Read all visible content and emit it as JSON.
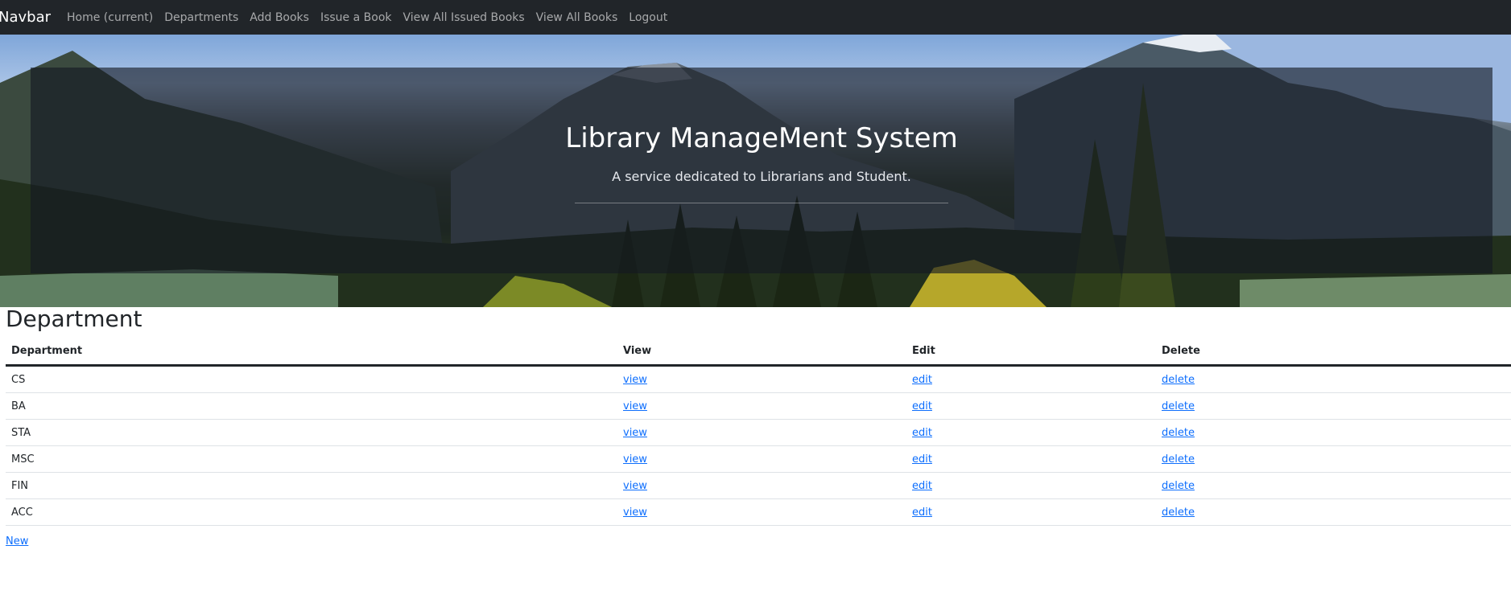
{
  "navbar": {
    "brand": "Navbar",
    "items": [
      {
        "label": "Home (current)"
      },
      {
        "label": "Departments"
      },
      {
        "label": "Add Books"
      },
      {
        "label": "Issue a Book"
      },
      {
        "label": "View All Issued Books"
      },
      {
        "label": "View All Books"
      },
      {
        "label": "Logout"
      }
    ]
  },
  "hero": {
    "title": "Library ManageMent System",
    "subtitle": "A service dedicated to Librarians and Student."
  },
  "page": {
    "heading": "Department",
    "new_label": "New"
  },
  "table": {
    "headers": [
      "Department",
      "View",
      "Edit",
      "Delete"
    ],
    "rows": [
      {
        "department": "CS",
        "view": "view",
        "edit": "edit",
        "delete": "delete"
      },
      {
        "department": "BA",
        "view": "view",
        "edit": "edit",
        "delete": "delete"
      },
      {
        "department": "STA",
        "view": "view",
        "edit": "edit",
        "delete": "delete"
      },
      {
        "department": "MSC",
        "view": "view",
        "edit": "edit",
        "delete": "delete"
      },
      {
        "department": "FIN",
        "view": "view",
        "edit": "edit",
        "delete": "delete"
      },
      {
        "department": "ACC",
        "view": "view",
        "edit": "edit",
        "delete": "delete"
      }
    ]
  },
  "colors": {
    "navbar_bg": "#212529",
    "link": "#0d6efd",
    "text": "#212529"
  }
}
